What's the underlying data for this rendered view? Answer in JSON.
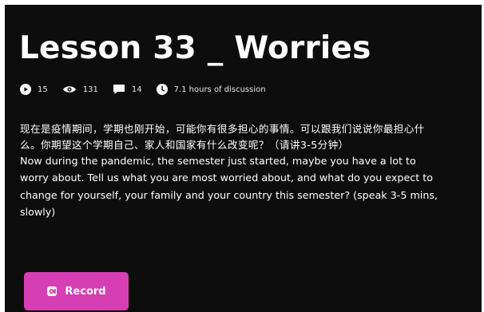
{
  "lesson": {
    "title": "Lesson 33 _ Worries"
  },
  "stats": {
    "plays": "15",
    "views": "131",
    "comments": "14",
    "discussion_time": "7.1 hours of discussion",
    "icons": [
      "play-icon",
      "eye-icon",
      "comment-icon",
      "clock-icon"
    ]
  },
  "prompt": {
    "chinese": "现在是疫情期间，学期也刚开始，可能你有很多担心的事情。可以跟我们说说你最担心什么。你期望这个学期自己、家人和国家有什么改变呢？（请讲3-5分钟）",
    "english": "Now during the pandemic, the semester just started, maybe you have a lot to worry about. Tell us what you are most worried about, and what do you expect to change for yourself, your family and your country this semester? (speak 3-5 mins, slowly)"
  },
  "actions": {
    "record_label": "Record",
    "record_icon": "record-icon"
  },
  "colors": {
    "background": "#0d0d0d",
    "text": "#ffffff",
    "accent": "#d63fb3"
  }
}
